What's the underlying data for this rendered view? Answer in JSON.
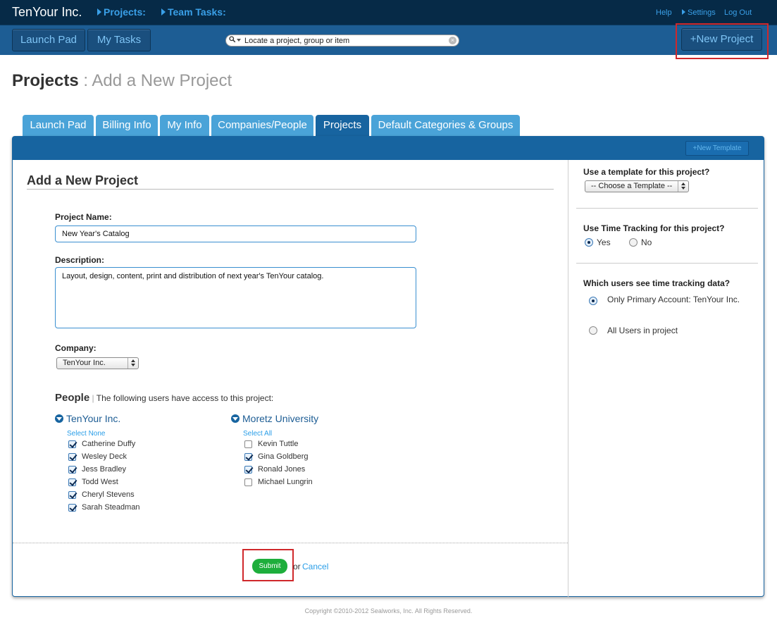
{
  "topbar": {
    "brand": "TenYour Inc.",
    "nav": [
      "Projects:",
      "Team Tasks:"
    ],
    "help": "Help",
    "settings": "Settings",
    "logout": "Log Out"
  },
  "toolbar": {
    "launch_pad": "Launch Pad",
    "my_tasks": "My Tasks",
    "search_placeholder": "Locate a project, group or item",
    "new_project": "+New Project"
  },
  "page": {
    "title_strong": "Projects",
    "title_light": " : Add a New Project"
  },
  "tabs": [
    "Launch Pad",
    "Billing Info",
    "My Info",
    "Companies/People",
    "Projects",
    "Default Categories & Groups"
  ],
  "active_tab": "Projects",
  "panel": {
    "new_template": "+New Template"
  },
  "form": {
    "title": "Add a New Project",
    "project_name_label": "Project Name:",
    "project_name_value": "New Year's Catalog",
    "description_label": "Description:",
    "description_value": "Layout, design, content, print and distribution of next year's TenYour catalog.",
    "company_label": "Company:",
    "company_value": "TenYour Inc.",
    "people_label": "People",
    "people_note": "The following users have access to this project:",
    "groups": [
      {
        "name": "TenYour Inc.",
        "select_link": "Select None",
        "users": [
          {
            "name": "Catherine Duffy",
            "checked": true
          },
          {
            "name": "Wesley Deck",
            "checked": true
          },
          {
            "name": "Jess Bradley",
            "checked": true
          },
          {
            "name": "Todd West",
            "checked": true
          },
          {
            "name": "Cheryl Stevens",
            "checked": true
          },
          {
            "name": "Sarah Steadman",
            "checked": true
          }
        ]
      },
      {
        "name": "Moretz University",
        "select_link": "Select All",
        "users": [
          {
            "name": "Kevin Tuttle",
            "checked": false
          },
          {
            "name": "Gina Goldberg",
            "checked": true
          },
          {
            "name": "Ronald Jones",
            "checked": true
          },
          {
            "name": "Michael Lungrin",
            "checked": false
          }
        ]
      }
    ],
    "submit": "Submit",
    "or": "or",
    "cancel": "Cancel"
  },
  "sidebar": {
    "template_q": "Use a template for this project?",
    "template_value": "-- Choose a Template --",
    "tracking_q": "Use Time Tracking for this project?",
    "tracking_yes": "Yes",
    "tracking_no": "No",
    "tracking_selected": "Yes",
    "visibility_q": "Which users see time tracking data?",
    "visibility_opt1": "Only Primary Account: TenYour Inc.",
    "visibility_opt2": "All Users in project",
    "visibility_selected": 1
  },
  "footer": {
    "copyright": "Copyright ©2010-2012 Sealworks, Inc. All Rights Reserved."
  }
}
